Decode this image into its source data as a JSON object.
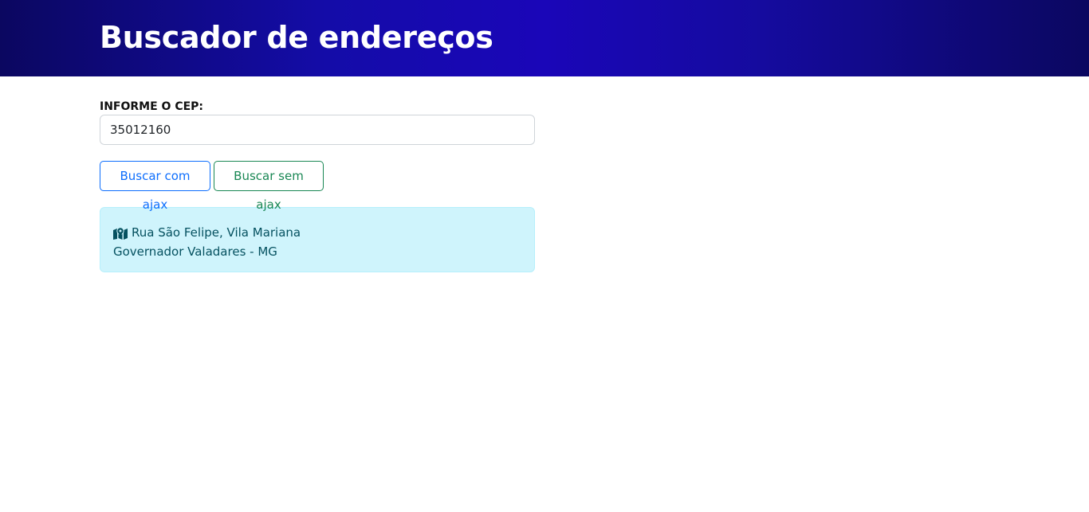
{
  "header": {
    "title": "Buscador de endereços"
  },
  "form": {
    "cep_label": "INFORME O CEP:",
    "cep_value": "35012160"
  },
  "buttons": {
    "ajax_label": "Buscar com ajax",
    "no_ajax_label": "Buscar sem ajax"
  },
  "result": {
    "icon": "map-location-icon",
    "street_line": "Rua São Felipe, Vila Mariana",
    "city_line": "Governador Valadares - MG"
  },
  "colors": {
    "header_bg": "#1a06b8",
    "primary": "#0d6efd",
    "success": "#198754",
    "info_bg": "#cff4fc",
    "info_text": "#055160"
  }
}
